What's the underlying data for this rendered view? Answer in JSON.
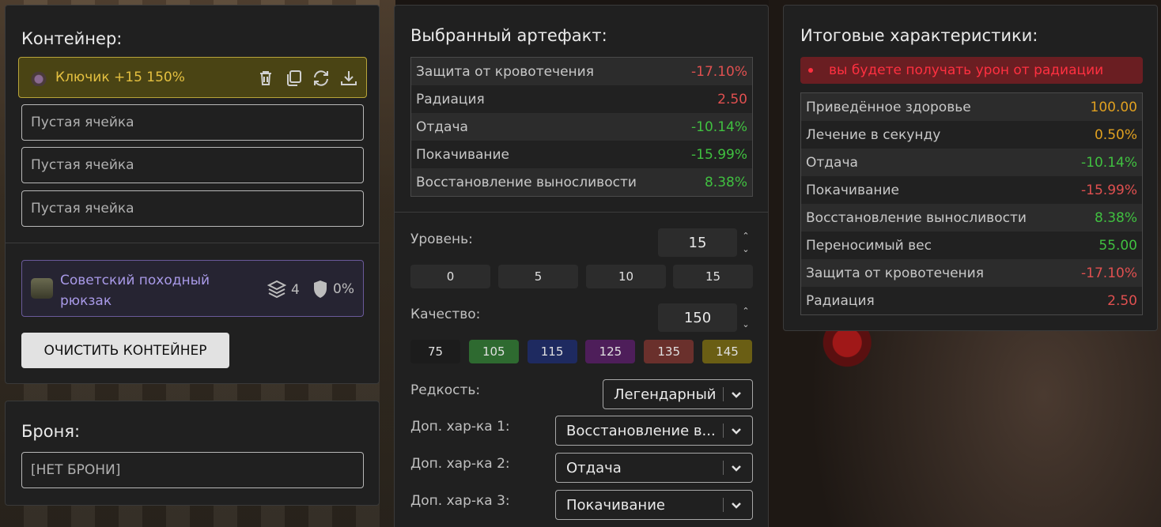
{
  "container": {
    "title": "Контейнер:",
    "active_slot": "Ключик +15 150%",
    "empty_slots": [
      "Пустая ячейка",
      "Пустая ячейка",
      "Пустая ячейка"
    ],
    "backpack": {
      "name": "Советский походный рюкзак",
      "slots": "4",
      "protection": "0%"
    },
    "clear_button": "ОЧИСТИТЬ КОНТЕЙНЕР"
  },
  "armor": {
    "title": "Броня:",
    "value": "[НЕТ БРОНИ]"
  },
  "artifact": {
    "title": "Выбранный артефакт:",
    "stats": [
      {
        "name": "Защита от кровотечения",
        "value": "-17.10%",
        "tone": "neg"
      },
      {
        "name": "Радиация",
        "value": "2.50",
        "tone": "neg"
      },
      {
        "name": "Отдача",
        "value": "-10.14%",
        "tone": "pos"
      },
      {
        "name": "Покачивание",
        "value": "-15.99%",
        "tone": "pos"
      },
      {
        "name": "Восстановление выносливости",
        "value": "8.38%",
        "tone": "pos"
      }
    ],
    "level_label": "Уровень:",
    "level_value": "15",
    "level_presets": [
      "0",
      "5",
      "10",
      "15"
    ],
    "quality_label": "Качество:",
    "quality_value": "150",
    "quality_presets": [
      "75",
      "105",
      "115",
      "125",
      "135",
      "145"
    ],
    "quality_colors": [
      "#1c1c1c",
      "#2e6a30",
      "#1e2a60",
      "#4e1e5a",
      "#6a302c",
      "#6a5e14"
    ],
    "rarity_label": "Редкость:",
    "rarity_value": "Легендарный",
    "extra1_label": "Доп. хар-ка 1:",
    "extra1_value": "Восстановление в...",
    "extra2_label": "Доп. хар-ка 2:",
    "extra2_value": "Отдача",
    "extra3_label": "Доп. хар-ка 3:",
    "extra3_value": "Покачивание"
  },
  "totals": {
    "title": "Итоговые характеристики:",
    "warning": "вы будете получать урон от радиации",
    "stats": [
      {
        "name": "Приведённое здоровье",
        "value": "100.00",
        "tone": "gold"
      },
      {
        "name": "Лечение в секунду",
        "value": "0.50%",
        "tone": "gold"
      },
      {
        "name": "Отдача",
        "value": "-10.14%",
        "tone": "pos"
      },
      {
        "name": "Покачивание",
        "value": "-15.99%",
        "tone": "neg"
      },
      {
        "name": "Восстановление выносливости",
        "value": "8.38%",
        "tone": "pos"
      },
      {
        "name": "Переносимый вес",
        "value": "55.00",
        "tone": "pos"
      },
      {
        "name": "Защита от кровотечения",
        "value": "-17.10%",
        "tone": "neg"
      },
      {
        "name": "Радиация",
        "value": "2.50",
        "tone": "neg"
      }
    ]
  }
}
